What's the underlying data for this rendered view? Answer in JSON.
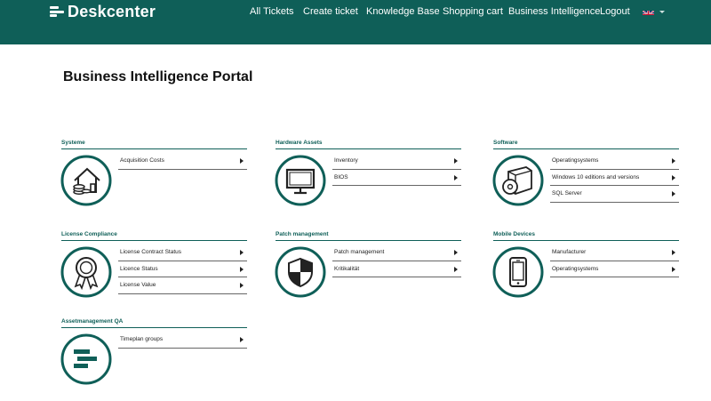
{
  "header": {
    "brand": "Deskcenter",
    "nav": [
      {
        "label": "All Tickets"
      },
      {
        "label": "Create ticket"
      },
      {
        "label": "Knowledge Base"
      },
      {
        "label": "Shopping cart"
      },
      {
        "label": "Business Intelligence"
      },
      {
        "label": "Logout"
      }
    ],
    "language_icon": "uk-flag-icon"
  },
  "page_title": "Business Intelligence Portal",
  "colors": {
    "brand": "#0f5f58",
    "text": "#222222",
    "background": "#ffffff"
  },
  "sections": [
    {
      "title": "Systeme",
      "icon": "house-coins-icon",
      "links": [
        {
          "label": "Acquisition Costs"
        }
      ]
    },
    {
      "title": "Hardware Assets",
      "icon": "monitor-icon",
      "links": [
        {
          "label": "Inventory"
        },
        {
          "label": "BIOS"
        }
      ]
    },
    {
      "title": "Software",
      "icon": "software-box-icon",
      "links": [
        {
          "label": "Operatingsystems"
        },
        {
          "label": "Windows 10 editions and versions"
        },
        {
          "label": "SQL Server"
        }
      ]
    },
    {
      "title": "License Compliance",
      "icon": "award-rosette-icon",
      "links": [
        {
          "label": "License Contract Status"
        },
        {
          "label": "Licence Status"
        },
        {
          "label": "License Value"
        }
      ]
    },
    {
      "title": "Patch management",
      "icon": "shield-icon",
      "links": [
        {
          "label": "Patch management"
        },
        {
          "label": "Kritikalität"
        }
      ]
    },
    {
      "title": "Mobile Devices",
      "icon": "smartphone-icon",
      "links": [
        {
          "label": "Manufacturer"
        },
        {
          "label": "Operatingsystems"
        }
      ]
    },
    {
      "title": "Assetmanagement QA",
      "icon": "timeline-bars-icon",
      "links": [
        {
          "label": "Timeplan groups"
        }
      ]
    }
  ]
}
